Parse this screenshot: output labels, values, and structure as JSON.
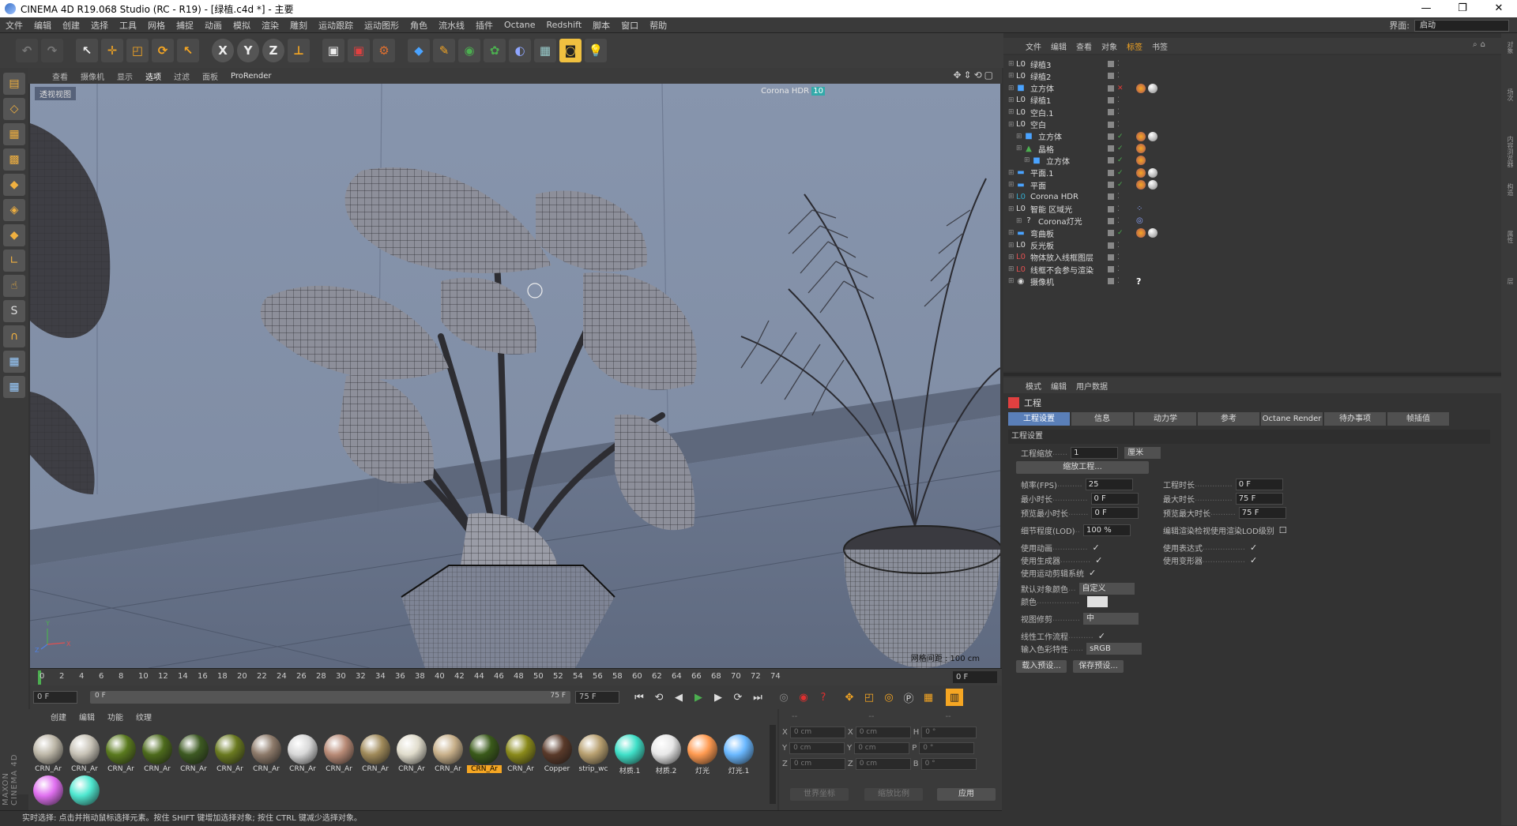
{
  "window": {
    "title": "CINEMA 4D R19.068 Studio (RC - R19) - [绿植.c4d *] - 主要",
    "controls": [
      "—",
      "❐",
      "✕"
    ]
  },
  "menubar": {
    "items": [
      "文件",
      "编辑",
      "创建",
      "选择",
      "工具",
      "网格",
      "捕捉",
      "动画",
      "模拟",
      "渲染",
      "雕刻",
      "运动跟踪",
      "运动图形",
      "角色",
      "流水线",
      "插件",
      "Octane",
      "Redshift",
      "脚本",
      "窗口",
      "帮助"
    ],
    "layout_label": "界面:",
    "layout_value": "启动"
  },
  "toolbar": {
    "axis_x": "X",
    "axis_y": "Y",
    "axis_z": "Z"
  },
  "viewport": {
    "menu": [
      "查看",
      "摄像机",
      "显示",
      "选项",
      "过滤",
      "面板",
      "ProRender"
    ],
    "active_menu": "选项",
    "label": "透视视图",
    "corona_tag": "Corona HDR",
    "corona_badge": "10",
    "grid_spacing": "网格间距 : 100 cm",
    "axis_labels": {
      "y": "Y",
      "x": "X",
      "z": "Z"
    }
  },
  "timeline": {
    "ticks": [
      "0",
      "2",
      "4",
      "6",
      "8",
      "10",
      "12",
      "14",
      "16",
      "18",
      "20",
      "22",
      "24",
      "26",
      "28",
      "30",
      "32",
      "34",
      "36",
      "38",
      "40",
      "42",
      "44",
      "46",
      "48",
      "50",
      "52",
      "54",
      "56",
      "58",
      "60",
      "62",
      "64",
      "66",
      "68",
      "70",
      "72",
      "74"
    ],
    "current_frame": "0 F"
  },
  "transport": {
    "start": "0 F",
    "range_start": "0 F",
    "range_end": "75 F",
    "end": "75 F"
  },
  "materials": {
    "menu": [
      "创建",
      "编辑",
      "功能",
      "纹理"
    ],
    "items": [
      {
        "name": "CRN_Ar",
        "color": "#bdb7a8"
      },
      {
        "name": "CRN_Ar",
        "color": "#c7c2b6"
      },
      {
        "name": "CRN_Ar",
        "color": "#5a7a1e"
      },
      {
        "name": "CRN_Ar",
        "color": "#4d6b1c"
      },
      {
        "name": "CRN_Ar",
        "color": "#3d5a22"
      },
      {
        "name": "CRN_Ar",
        "color": "#6a7a20"
      },
      {
        "name": "CRN_Ar",
        "color": "#8d7a6a"
      },
      {
        "name": "CRN_Ar",
        "color": "#d8d8d8"
      },
      {
        "name": "CRN_Ar",
        "color": "#b88a76"
      },
      {
        "name": "CRN_Ar",
        "color": "#a08a5a"
      },
      {
        "name": "CRN_Ar",
        "color": "#e0dccc"
      },
      {
        "name": "CRN_Ar",
        "color": "#c8b08a"
      },
      {
        "name": "CRN_Ar",
        "color": "#3a5a1a",
        "selected": true
      },
      {
        "name": "CRN_Ar",
        "color": "#8a8a1a"
      },
      {
        "name": "Copper",
        "color": "#5a3a2a"
      },
      {
        "name": "strip_wc",
        "color": "#b8a070"
      },
      {
        "name": "材质.1",
        "color": "#3fe0c8"
      },
      {
        "name": "材质.2",
        "color": "#e8e8e8"
      },
      {
        "name": "灯光",
        "color": "#ff9a50"
      },
      {
        "name": "灯光.1",
        "color": "#6ab8ff"
      },
      {
        "name": "",
        "color": "#e070f0"
      },
      {
        "name": "",
        "color": "#4fe8d0"
      }
    ]
  },
  "coords": {
    "headers": [
      "--",
      "--",
      "--"
    ],
    "rows": [
      {
        "a": "X",
        "av": "0 cm",
        "b": "X",
        "bv": "0 cm",
        "c": "H",
        "cv": "0 °"
      },
      {
        "a": "Y",
        "av": "0 cm",
        "b": "Y",
        "bv": "0 cm",
        "c": "P",
        "cv": "0 °"
      },
      {
        "a": "Z",
        "av": "0 cm",
        "b": "Z",
        "bv": "0 cm",
        "c": "B",
        "cv": "0 °"
      }
    ],
    "mode1": "世界坐标",
    "mode2": "缩放比例",
    "apply": "应用"
  },
  "status": "实时选择: 点击并拖动鼠标选择元素。按住 SHIFT 键增加选择对象; 按住 CTRL 键减少选择对象。",
  "objmanager": {
    "menu": [
      "文件",
      "编辑",
      "查看",
      "对象",
      "标签",
      "书签"
    ],
    "active_menu": "标签",
    "objects": [
      {
        "name": "绿植3",
        "icon": "L0",
        "iconColor": "#ddd",
        "indent": 0
      },
      {
        "name": "绿植2",
        "icon": "L0",
        "iconColor": "#ddd",
        "indent": 0
      },
      {
        "name": "立方体",
        "icon": "■",
        "iconColor": "#4aa3ff",
        "indent": 0
      },
      {
        "name": "绿植1",
        "icon": "L0",
        "iconColor": "#ddd",
        "indent": 0
      },
      {
        "name": "空白.1",
        "icon": "L0",
        "iconColor": "#ddd",
        "indent": 0
      },
      {
        "name": "空白",
        "icon": "L0",
        "iconColor": "#ddd",
        "indent": 0
      },
      {
        "name": "立方体",
        "icon": "■",
        "iconColor": "#4aa3ff",
        "indent": 1
      },
      {
        "name": "晶格",
        "icon": "▲",
        "iconColor": "#4caf50",
        "indent": 1
      },
      {
        "name": "立方体",
        "icon": "■",
        "iconColor": "#4aa3ff",
        "indent": 2
      },
      {
        "name": "平面.1",
        "icon": "▬",
        "iconColor": "#4aa3ff",
        "indent": 0
      },
      {
        "name": "平面",
        "icon": "▬",
        "iconColor": "#4aa3ff",
        "indent": 0
      },
      {
        "name": "Corona HDR",
        "icon": "L0",
        "iconColor": "#3ac",
        "indent": 0
      },
      {
        "name": "智能 区域光",
        "icon": "L0",
        "iconColor": "#ddd",
        "indent": 0
      },
      {
        "name": "Corona灯光",
        "icon": "?",
        "iconColor": "#ddd",
        "indent": 1
      },
      {
        "name": "弯曲板",
        "icon": "▬",
        "iconColor": "#4aa3ff",
        "indent": 0
      },
      {
        "name": "反光板",
        "icon": "L0",
        "iconColor": "#ddd",
        "indent": 0
      },
      {
        "name": "物体放入线框图层",
        "icon": "L0",
        "iconColor": "#e05050",
        "indent": 0
      },
      {
        "name": "线框不会参与渲染",
        "icon": "L0",
        "iconColor": "#e05050",
        "indent": 0
      },
      {
        "name": "摄像机",
        "icon": "◉",
        "iconColor": "#ddd",
        "indent": 0
      }
    ]
  },
  "attributes": {
    "menu": [
      "模式",
      "编辑",
      "用户数据"
    ],
    "header": "工程",
    "tabs": [
      "工程设置",
      "信息",
      "动力学",
      "参考",
      "Octane Render",
      "待办事项",
      "帧插值"
    ],
    "section": "工程设置",
    "scale_label": "工程缩放",
    "scale_value": "1",
    "scale_unit": "厘米",
    "scale_button": "缩放工程...",
    "fps_label": "帧率(FPS)",
    "fps_value": "25",
    "duration_label": "工程时长",
    "duration_value": "0 F",
    "min_time_label": "最小时长",
    "min_time_value": "0 F",
    "max_time_label": "最大时长",
    "max_time_value": "75 F",
    "prev_min_label": "预览最小时长",
    "prev_min_value": "0 F",
    "prev_max_label": "预览最大时长",
    "prev_max_value": "75 F",
    "lod_label": "细节程度(LOD)",
    "lod_value": "100 %",
    "lod_render_label": "编辑渲染检视使用渲染LOD级别",
    "anim_label": "使用动画",
    "expr_label": "使用表达式",
    "gen_label": "使用生成器",
    "deform_label": "使用变形器",
    "motion_label": "使用运动剪辑系统",
    "objcolor_label": "默认对象颜色",
    "objcolor_value": "自定义",
    "color_label": "颜色",
    "clip_label": "视图修剪",
    "clip_value": "中",
    "linear_label": "线性工作流程",
    "input_color_label": "输入色彩特性",
    "input_color_value": "sRGB",
    "load_preset": "载入预设...",
    "save_preset": "保存预设..."
  },
  "rstrip": [
    "对象",
    "场次",
    "内容浏览器",
    "构造",
    "属性",
    "层"
  ]
}
